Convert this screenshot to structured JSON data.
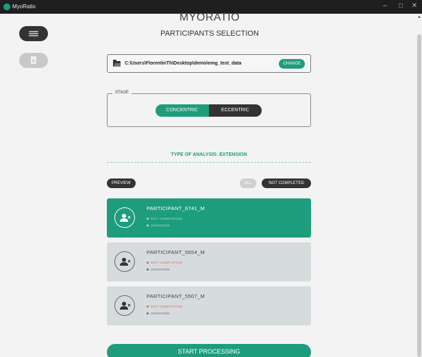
{
  "window": {
    "title": "MyoRatio",
    "controls": [
      "–",
      "□",
      "✕"
    ]
  },
  "sidebar": {
    "items": [
      {
        "icon": "hamburger-menu-icon"
      },
      {
        "icon": "document-icon"
      }
    ]
  },
  "header": {
    "app_title": "MYORATIO",
    "page_title": "PARTICIPANTS SELECTION"
  },
  "folder": {
    "icon": "folder-icon",
    "path": "C:\\Users\\FlorentinTh\\Desktop\\demo\\emg_test_data",
    "change_label": "CHANGE"
  },
  "stage": {
    "legend": "STAGE",
    "options": [
      "CONCENTRIC",
      "ECCENTRIC"
    ],
    "selected": "CONCENTRIC"
  },
  "analysis": {
    "title": "TYPE OF ANALYSIS: EXTENSION"
  },
  "toolbar": {
    "preview_label": "PREVIEW",
    "filter_all_label": "ALL",
    "filter_not_completed_label": "NOT COMPLETED"
  },
  "participants": [
    {
      "name": "PARTICIPANT_6741_M",
      "status": "NOT COMPLETED",
      "info": "UNKNOWN",
      "selected": true
    },
    {
      "name": "PARTICIPANT_5654_M",
      "status": "NOT COMPLETED",
      "info": "UNKNOWN",
      "selected": false
    },
    {
      "name": "PARTICIPANT_5507_M",
      "status": "NOT COMPLETED",
      "info": "UNKNOWN",
      "selected": false
    }
  ],
  "actions": {
    "start_label": "START PROCESSING"
  },
  "colors": {
    "accent": "#1e9c7e",
    "dark": "#333333",
    "card": "#d6dbdd",
    "error": "#e06050"
  }
}
